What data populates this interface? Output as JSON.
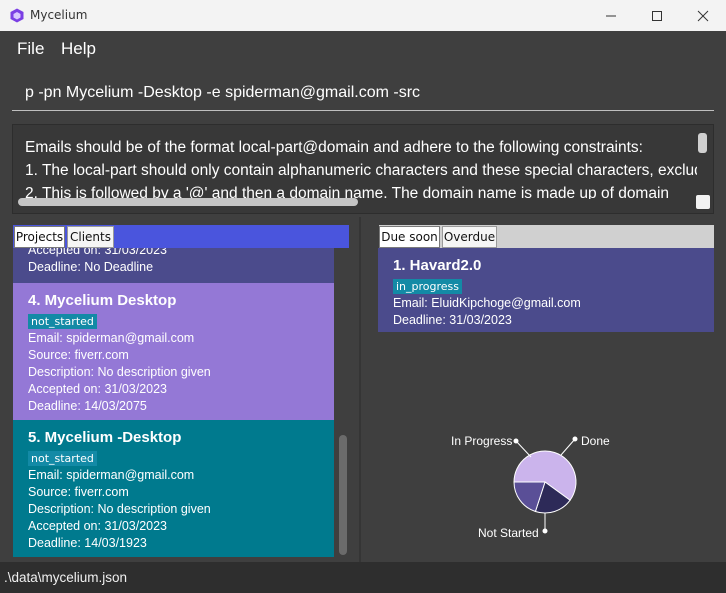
{
  "window": {
    "title": "Mycelium",
    "icon": "hexagon-app-icon"
  },
  "menu": {
    "file": "File",
    "help": "Help"
  },
  "command": {
    "value": "p -pn Mycelium -Desktop -e spiderman@gmail.com -src"
  },
  "result": {
    "lines": [
      "Emails should be of the format local-part@domain and adhere to the following constraints:",
      "1. The local-part should only contain alphanumeric characters and these special characters, excluding",
      "2. This is followed by a '@' and then a domain name. The domain name is made up of domain"
    ]
  },
  "left_tabs": {
    "projects": "Projects",
    "clients": "Clients"
  },
  "projects": [
    {
      "accepted": "Accepted on: 31/03/2023",
      "deadline": "Deadline: No Deadline"
    },
    {
      "title": "4.  Mycelium Desktop",
      "status": "not_started",
      "email": "Email: spiderman@gmail.com",
      "source": "Source: fiverr.com",
      "description": "Description: No description given",
      "accepted": "Accepted on: 31/03/2023",
      "deadline": "Deadline: 14/03/2075"
    },
    {
      "title": "5.  Mycelium -Desktop",
      "status": "not_started",
      "email": "Email: spiderman@gmail.com",
      "source": "Source: fiverr.com",
      "description": "Description: No description given",
      "accepted": "Accepted on: 31/03/2023",
      "deadline": "Deadline: 14/03/1923"
    }
  ],
  "right_tabs": {
    "due_soon": "Due soon",
    "overdue": "Overdue"
  },
  "due_soon": [
    {
      "title": "1.  Havard2.0",
      "status": "in_progress",
      "email": "Email: EluidKipchoge@gmail.com",
      "deadline": "Deadline: 31/03/2023"
    }
  ],
  "pie": {
    "labels": {
      "in_progress": "In Progress",
      "done": "Done",
      "not_started": "Not Started"
    },
    "shares": {
      "not_started": 0.6,
      "in_progress": 0.2,
      "done": 0.2
    },
    "colors": {
      "not_started": "#cbb4ec",
      "in_progress": "#5a4f97",
      "done": "#2d2a58"
    }
  },
  "status_bar": {
    "path": ".\\data\\mycelium.json"
  },
  "colors": {
    "project_card_4": "#9478d6",
    "project_card_5": "#007a8e",
    "project_card_top": "#4b4b8c",
    "badge": "#138aa6",
    "tab_strip": "#4a55dd"
  }
}
